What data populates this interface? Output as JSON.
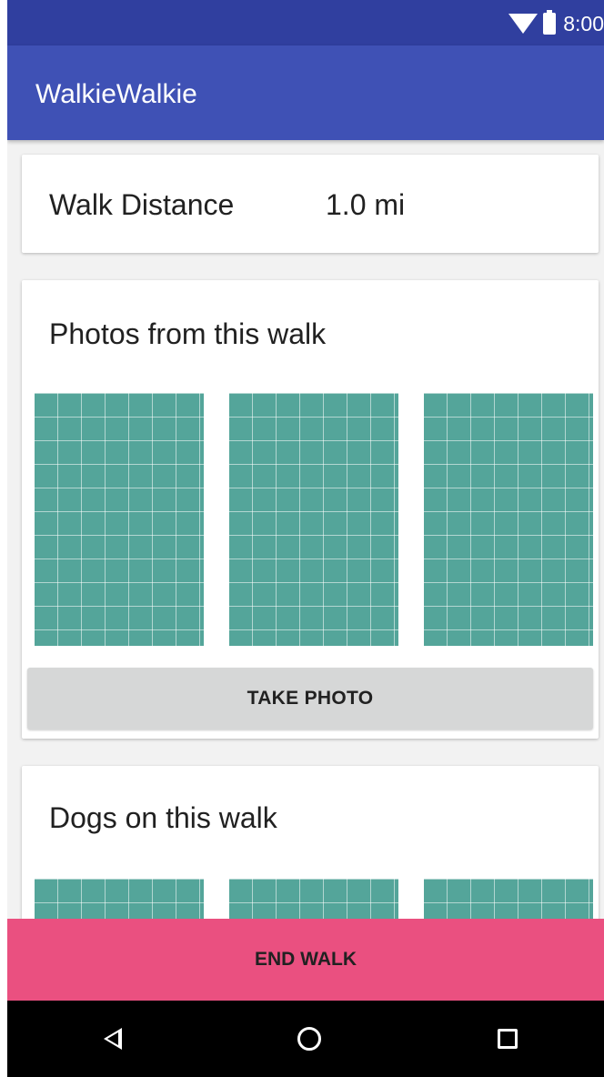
{
  "status_bar": {
    "time": "8:00",
    "icons": [
      "wifi-icon",
      "battery-icon"
    ]
  },
  "app_bar": {
    "title": "WalkieWalkie"
  },
  "distance_card": {
    "label": "Walk Distance",
    "value": "1.0 mi"
  },
  "photos_card": {
    "heading": "Photos from this walk",
    "photo_count": 3,
    "button_label": "TAKE PHOTO"
  },
  "dogs_card": {
    "heading": "Dogs on this walk",
    "dog_count": 3
  },
  "end_walk": {
    "label": "END WALK"
  },
  "nav_bar": {
    "icons": [
      "back-icon",
      "home-icon",
      "recents-icon"
    ]
  },
  "colors": {
    "status_bar": "#303f9f",
    "app_bar": "#3f51b5",
    "photo_tile": "#54a59a",
    "take_photo_button": "#d6d7d7",
    "end_walk_button": "#ea5080",
    "nav_bar": "#000000"
  }
}
